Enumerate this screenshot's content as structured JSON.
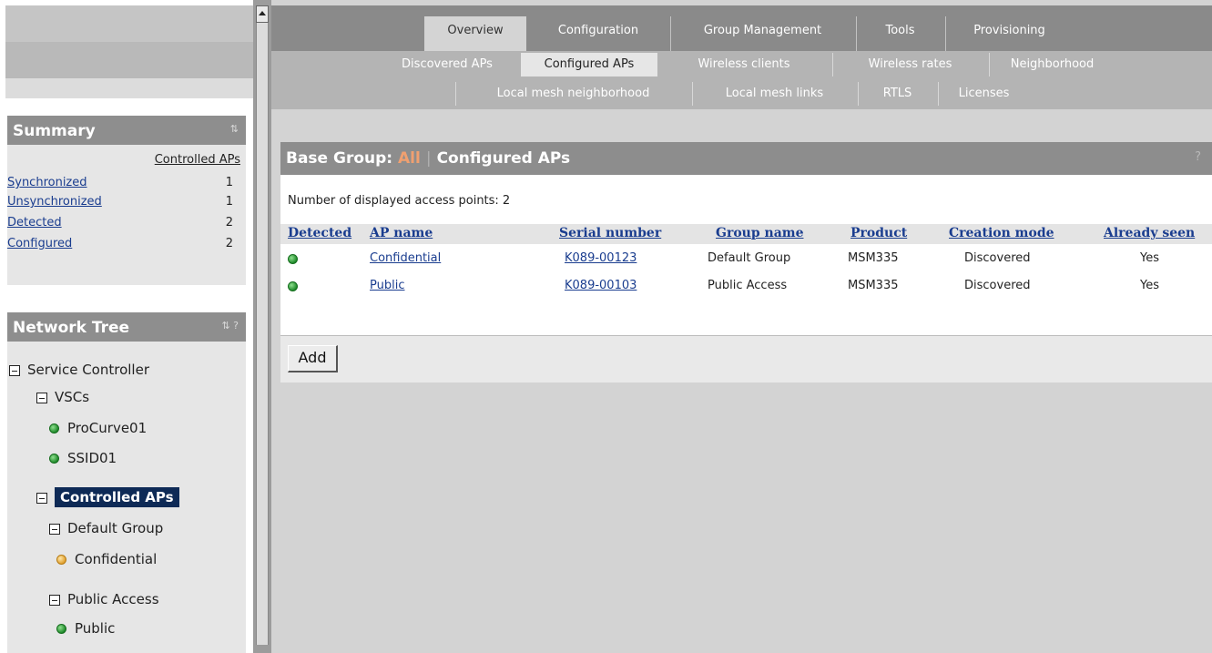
{
  "summary": {
    "title": "Summary",
    "refresh_icon": "⇅",
    "column_header": "Controlled APs",
    "rows": [
      {
        "label": "Synchronized",
        "value": "1"
      },
      {
        "label": "Unsynchronized",
        "value": "1"
      },
      {
        "label": "Detected",
        "value": "2"
      },
      {
        "label": "Configured",
        "value": "2"
      }
    ]
  },
  "network_tree": {
    "title": "Network Tree",
    "icons": "⇅ ?",
    "nodes": [
      {
        "label": "Service Controller"
      },
      {
        "label": "VSCs"
      },
      {
        "label": "ProCurve01",
        "status": "green"
      },
      {
        "label": "SSID01",
        "status": "green"
      },
      {
        "label": "Controlled APs",
        "selected": true
      },
      {
        "label": "Default Group"
      },
      {
        "label": "Confidential",
        "status": "orange"
      },
      {
        "label": "Public Access"
      },
      {
        "label": "Public",
        "status": "green"
      }
    ]
  },
  "tabs_primary": [
    {
      "label": "Overview",
      "active": true
    },
    {
      "label": "Configuration"
    },
    {
      "label": "Group Management"
    },
    {
      "label": "Tools"
    },
    {
      "label": "Provisioning"
    }
  ],
  "tabs_secondary": [
    {
      "label": "Discovered APs"
    },
    {
      "label": "Configured APs",
      "active": true
    },
    {
      "label": "Wireless clients"
    },
    {
      "label": "Wireless rates"
    },
    {
      "label": "Neighborhood"
    },
    {
      "label": "Local mesh neighborhood"
    },
    {
      "label": "Local mesh links"
    },
    {
      "label": "RTLS"
    },
    {
      "label": "Licenses"
    }
  ],
  "content": {
    "title_prefix": "Base Group: ",
    "base_group": "All",
    "separator": "|",
    "title_suffix": "Configured APs",
    "help": "?",
    "count_text": "Number of displayed access points: 2",
    "columns": [
      "Detected",
      "AP name",
      "Serial number",
      "Group name",
      "Product",
      "Creation mode",
      "Already seen"
    ],
    "rows": [
      {
        "ap_name": "Confidential",
        "serial": "K089-00123",
        "group": "Default Group",
        "product": "MSM335",
        "mode": "Discovered",
        "seen": "Yes"
      },
      {
        "ap_name": "Public",
        "serial": "K089-00103",
        "group": "Public Access",
        "product": "MSM335",
        "mode": "Discovered",
        "seen": "Yes"
      }
    ],
    "add_button": "Add"
  },
  "colors": {
    "status_green": "#1f8a2a",
    "status_orange": "#e0a030",
    "selected_bg": "#0e2a56",
    "link": "#1a3d8f",
    "base_group_accent": "#f0a070"
  }
}
